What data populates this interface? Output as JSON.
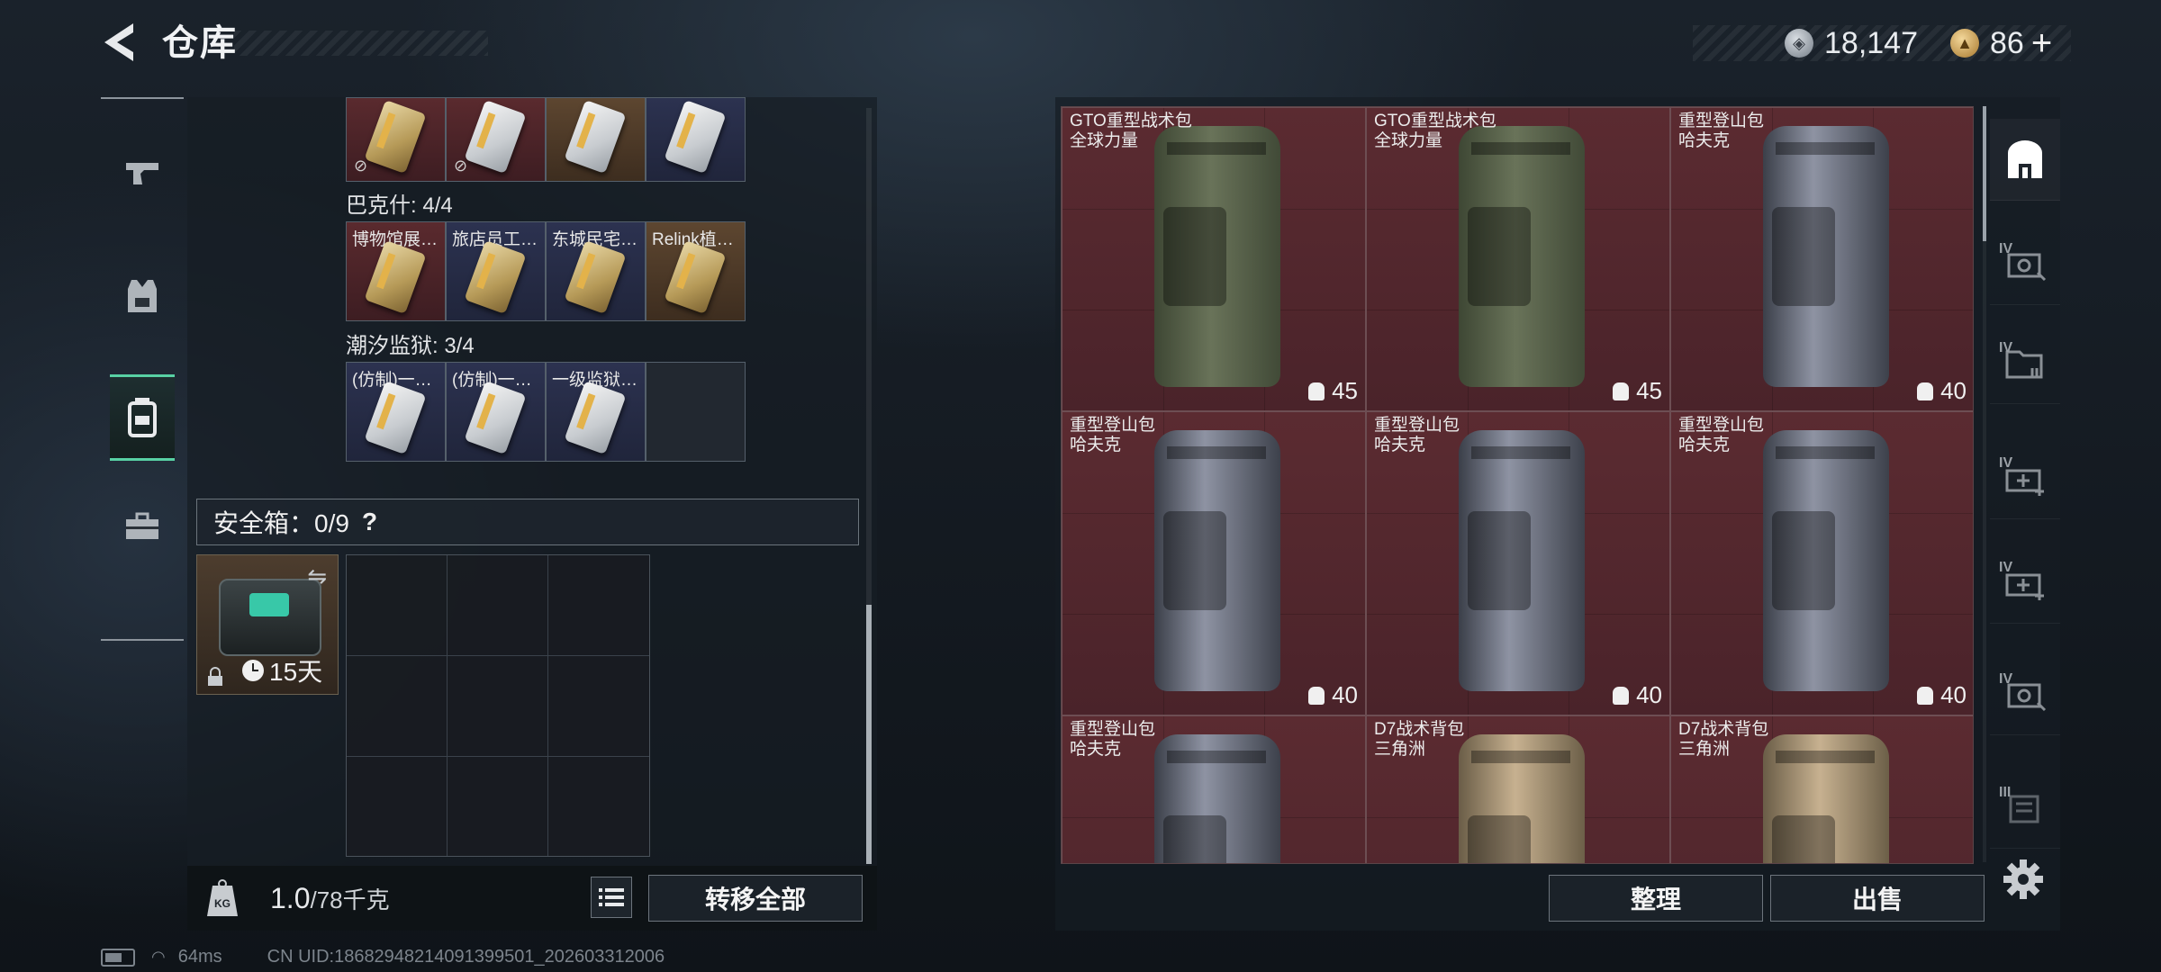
{
  "header": {
    "title": "仓库",
    "currency_silver": "18,147",
    "currency_gold": "86",
    "plus_label": "+"
  },
  "left": {
    "sections": [
      {
        "label": "巴克什: 4/4",
        "items": [
          "博物馆展…",
          "旅店员工…",
          "东城民宅…",
          "Relink植…"
        ]
      },
      {
        "label": "潮汐监狱: 3/4",
        "items": [
          "(仿制)一…",
          "(仿制)一…",
          "一级监狱…",
          ""
        ]
      }
    ],
    "safe_box_label": "安全箱：0/9",
    "safe_help": "?",
    "safebox_timer": "15天",
    "weight_value": "1.0",
    "weight_max": "/78千克",
    "transfer_all": "转移全部"
  },
  "stash": {
    "items": [
      {
        "name": "GTO重型战术包",
        "brand": "全球力量",
        "cap": "45",
        "color": "olive"
      },
      {
        "name": "GTO重型战术包",
        "brand": "全球力量",
        "cap": "45",
        "color": "olive"
      },
      {
        "name": "重型登山包",
        "brand": "哈夫克",
        "cap": "40",
        "color": "grey"
      },
      {
        "name": "重型登山包",
        "brand": "哈夫克",
        "cap": "40",
        "color": "grey"
      },
      {
        "name": "重型登山包",
        "brand": "哈夫克",
        "cap": "40",
        "color": "grey"
      },
      {
        "name": "重型登山包",
        "brand": "哈夫克",
        "cap": "40",
        "color": "grey"
      },
      {
        "name": "重型登山包",
        "brand": "哈夫克",
        "cap": "",
        "color": "grey"
      },
      {
        "name": "D7战术背包",
        "brand": "三角洲",
        "cap": "",
        "color": "tan"
      },
      {
        "name": "D7战术背包",
        "brand": "三角洲",
        "cap": "",
        "color": "tan"
      }
    ],
    "sort_label": "整理",
    "sell_label": "出售"
  },
  "filters": {
    "tiers": [
      "IV",
      "IV",
      "IV",
      "IV",
      "IV",
      "III"
    ]
  },
  "status": {
    "ping": "64ms",
    "uid": "CN UID:18682948214091399501_202603312006"
  },
  "colors": {
    "accent": "#58d1a4",
    "item_bg_red": "#5b2b31"
  }
}
